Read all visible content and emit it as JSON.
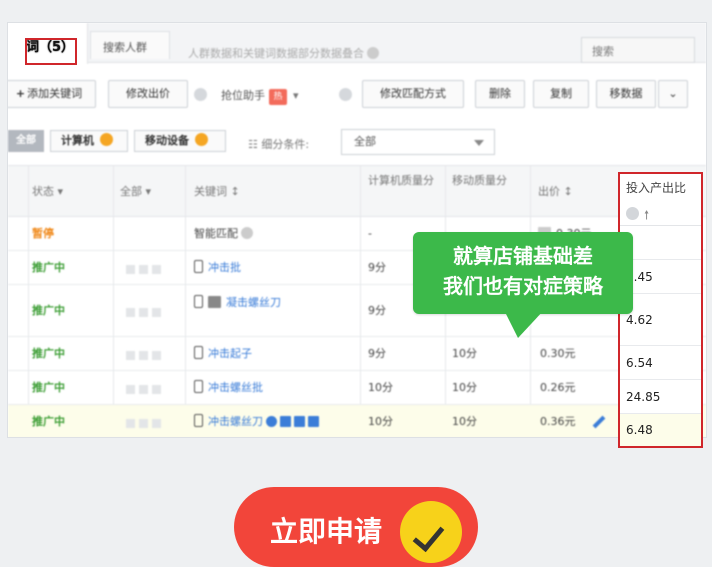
{
  "tabs": {
    "active_label": "词（5）",
    "second_label": "搜索人群",
    "note": "人群数据和关键词数据部分数据叠合",
    "search_placeholder": "搜索"
  },
  "toolbar": {
    "add_keyword": "添加关键词",
    "modify_bid": "修改出价",
    "rank_helper": "抢位助手",
    "hot_badge": "热",
    "modify_match": "修改匹配方式",
    "delete": "删除",
    "copy": "复制",
    "sync_data": "移数据"
  },
  "filter": {
    "all_tag": "全部",
    "computer": "计算机",
    "mobile": "移动设备",
    "subdivide_label": "细分条件:",
    "subdivide_value": "全部"
  },
  "table": {
    "headers": {
      "status": "状态",
      "all": "全部",
      "keyword": "关键词",
      "pc_quality": "计算机质量分",
      "mobile_quality": "移动质量分",
      "bid": "出价"
    },
    "rows": [
      {
        "status": "暂停",
        "keyword": "智能匹配",
        "pc_quality": "-",
        "mobile_quality": "",
        "bid": "0.30元"
      },
      {
        "status": "推广中",
        "keyword": "冲击批",
        "pc_quality": "9分",
        "mobile_quality": "",
        "bid": ""
      },
      {
        "status": "推广中",
        "keyword": "凝击螺丝刀",
        "pc_quality": "9分",
        "mobile_quality": "",
        "bid": ""
      },
      {
        "status": "推广中",
        "keyword": "冲击起子",
        "pc_quality": "9分",
        "mobile_quality": "10分",
        "bid": "0.30元"
      },
      {
        "status": "推广中",
        "keyword": "冲击螺丝批",
        "pc_quality": "10分",
        "mobile_quality": "10分",
        "bid": "0.26元"
      },
      {
        "status": "推广中",
        "keyword": "冲击螺丝刀",
        "pc_quality": "10分",
        "mobile_quality": "10分",
        "bid": "0.36元"
      }
    ]
  },
  "roi_column": {
    "title": "投入产出比",
    "values": [
      "",
      "1.45",
      "4.62",
      "6.54",
      "24.85",
      "6.48"
    ]
  },
  "bubble": {
    "line1": "就算店铺基础差",
    "line2": "我们也有对症策略"
  },
  "apply_button": {
    "label": "立即申请"
  },
  "colors": {
    "accent_red": "#d0262b",
    "bubble_green": "#3cb94a",
    "button_red": "#f2453a",
    "status_green": "#3d9e35"
  }
}
